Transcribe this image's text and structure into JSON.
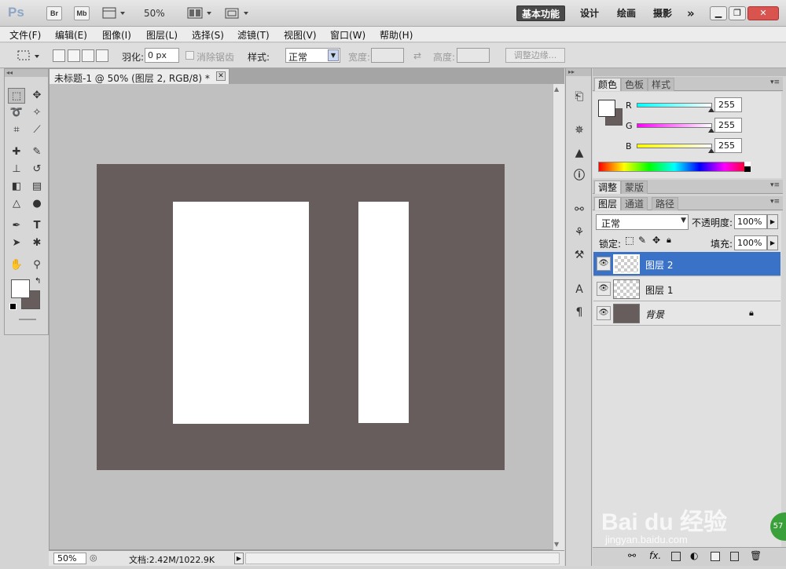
{
  "app": {
    "logo": "Ps",
    "bridge_btn": "Br",
    "mini_btn": "Mb",
    "zoom": "50%",
    "workspaces": [
      "基本功能",
      "设计",
      "绘画",
      "摄影"
    ],
    "more": "»"
  },
  "menu": [
    "文件(F)",
    "编辑(E)",
    "图像(I)",
    "图层(L)",
    "选择(S)",
    "滤镜(T)",
    "视图(V)",
    "窗口(W)",
    "帮助(H)"
  ],
  "options": {
    "feather_label": "羽化:",
    "feather_value": "0 px",
    "antialias_label": "消除锯齿",
    "style_label": "样式:",
    "style_value": "正常",
    "width_label": "宽度:",
    "height_label": "高度:",
    "refine_edge": "调整边缘..."
  },
  "document": {
    "tab_title": "未标题-1 @ 50% (图层 2, RGB/8) *",
    "status_zoom": "50%",
    "status_doc": "文档:2.42M/1022.9K",
    "canvas_color": "#665d5c"
  },
  "color_panel": {
    "tabs": [
      "颜色",
      "色板",
      "样式"
    ],
    "r_label": "R",
    "g_label": "G",
    "b_label": "B",
    "r_value": "255",
    "g_value": "255",
    "b_value": "255"
  },
  "adjust_panel": {
    "tabs": [
      "调整",
      "蒙版"
    ]
  },
  "layers_panel": {
    "tabs": [
      "图层",
      "通道",
      "路径"
    ],
    "blend_mode": "正常",
    "opacity_label": "不透明度:",
    "opacity_value": "100%",
    "lock_label": "锁定:",
    "fill_label": "填充:",
    "fill_value": "100%",
    "layers": [
      {
        "name": "图层 2",
        "selected": true
      },
      {
        "name": "图层 1",
        "selected": false
      },
      {
        "name": "背景",
        "selected": false
      }
    ]
  },
  "watermark": {
    "text": "Bai du 经验",
    "url": "jingyan.baidu.com",
    "badge": "57"
  }
}
